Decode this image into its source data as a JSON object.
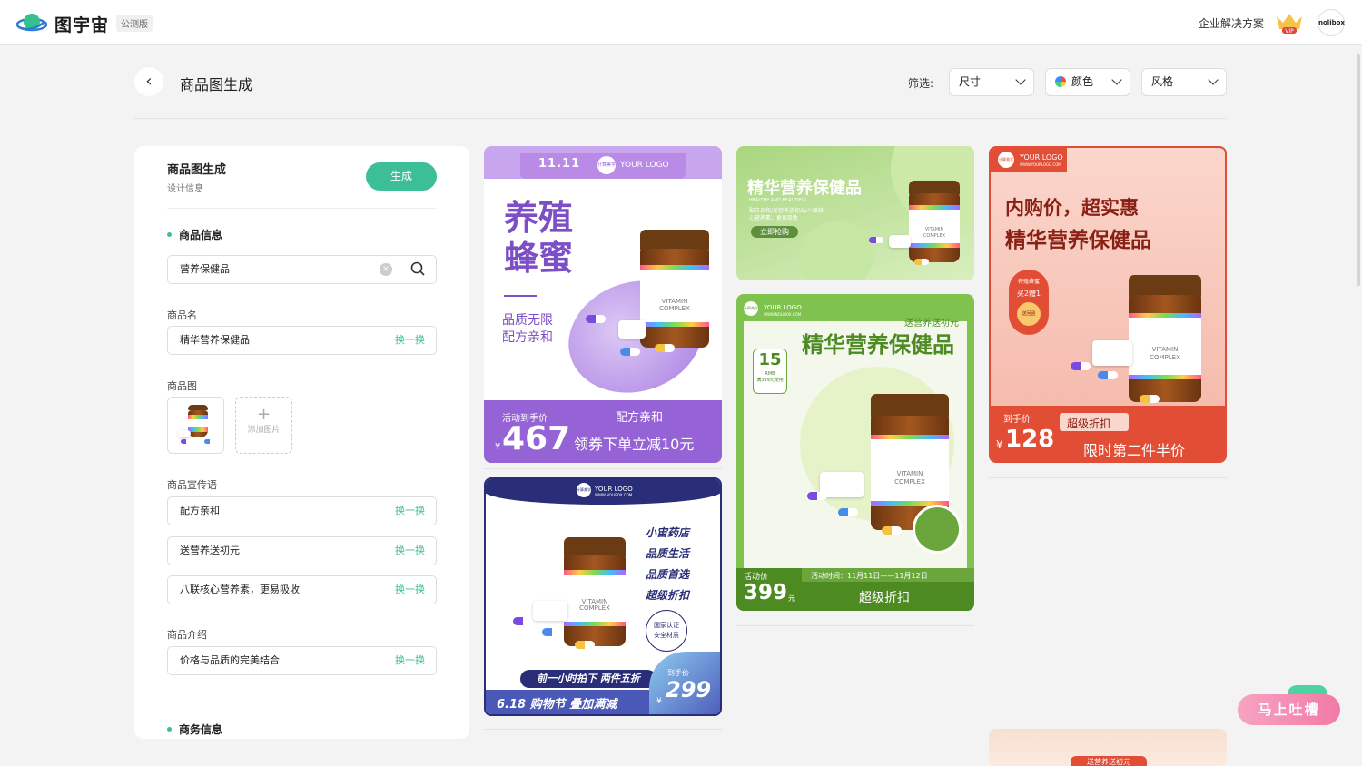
{
  "app": {
    "brand": "图宇宙",
    "beta_tag": "公测版",
    "enterprise_link": "企业解决方案",
    "vip_badge": "VIP",
    "avatar_text": "nolibox"
  },
  "header": {
    "title": "商品图生成",
    "filter_label": "筛选:",
    "filters": {
      "size": "尺寸",
      "color": "颜色",
      "style": "风格"
    }
  },
  "panel": {
    "title": "商品图生成",
    "subtitle": "设计信息",
    "generate_button": "生成",
    "section_product": "商品信息",
    "search_value": "营养保健品",
    "name_label": "商品名",
    "name_value": "精华营养保健品",
    "swap_label": "换一换",
    "image_label": "商品图",
    "add_image_label": "添加图片",
    "slogan_label": "商品宣传语",
    "slogans": [
      "配方亲和",
      "送营养送初元",
      "八联核心营养素，更易吸收"
    ],
    "intro_label": "商品介绍",
    "intro_value": "价格与品质的完美结合",
    "section_business": "商务信息"
  },
  "cards": {
    "c1": {
      "logo": "YOUR LOGO",
      "logo_badge": "计算美学",
      "title1": "养殖",
      "title2": "蜂蜜",
      "sub1": "品质无限",
      "sub2": "配方亲和",
      "activity": "活动到手价",
      "tag": "配方亲和",
      "currency": "¥",
      "price": "467",
      "coupon": "领券下单立减10元",
      "jar1": "VITAMIN",
      "jar2": "COMPLEX"
    },
    "c2": {
      "title": "精华营养保健品",
      "sub_en": "HEALTHY AND BEAUTIFUL",
      "desc1": "配方亲和/送营养送初元/八联核",
      "desc2": "心营养素，更易吸收",
      "button": "立即抢购",
      "jar1": "VITAMIN",
      "jar2": "COMPLEX"
    },
    "c3": {
      "logo": "YOUR LOGO",
      "logo_url": "WWW.YOURLOGO.COM",
      "logo_badge": "计算美学",
      "title1": "内购价，超实惠",
      "title2": "精华营养保健品",
      "tag1": "养殖蜂蜜",
      "tag2": "买2赠1",
      "tag3": "送回函",
      "price_label": "到手价",
      "currency": "¥",
      "price": "128",
      "discount": "超级折扣",
      "promo": "限时第二件半价",
      "jar1": "VITAMIN",
      "jar2": "COMPLEX"
    },
    "c4": {
      "logo": "YOUR LOGO",
      "logo_url": "WWW.NOLIBOX.COM",
      "logo_badge": "计算美学",
      "lines": [
        "小宙药店",
        "品质生活",
        "品质首选",
        "超级折扣"
      ],
      "cert1": "国家认证",
      "cert2": "安全材质",
      "promo": "前一小时拍下 两件五折",
      "festival": "6.18 购物节  叠加满减",
      "price_label": "到手价",
      "currency": "¥",
      "price": "299",
      "jar1": "VITAMIN",
      "jar2": "COMPLEX"
    },
    "c5": {
      "logo": "YOUR LOGO",
      "logo_url": "WWW.NOLIBOX.COM",
      "logo_badge": "计算美学",
      "gift": "送营养送初元",
      "title": "精华营养保健品",
      "coupon_value": "15",
      "coupon_unit": "RMB",
      "coupon_rule": "满399元使用",
      "activity": "活动价",
      "time": "活动时间：11月11日——11月12日",
      "price": "399",
      "unit": "元",
      "discount": "超级折扣",
      "jar1": "VITAMIN",
      "jar2": "COMPLEX"
    },
    "c6": {
      "gift": "送营养送初元"
    }
  },
  "feedback_button": "马上吐槽"
}
